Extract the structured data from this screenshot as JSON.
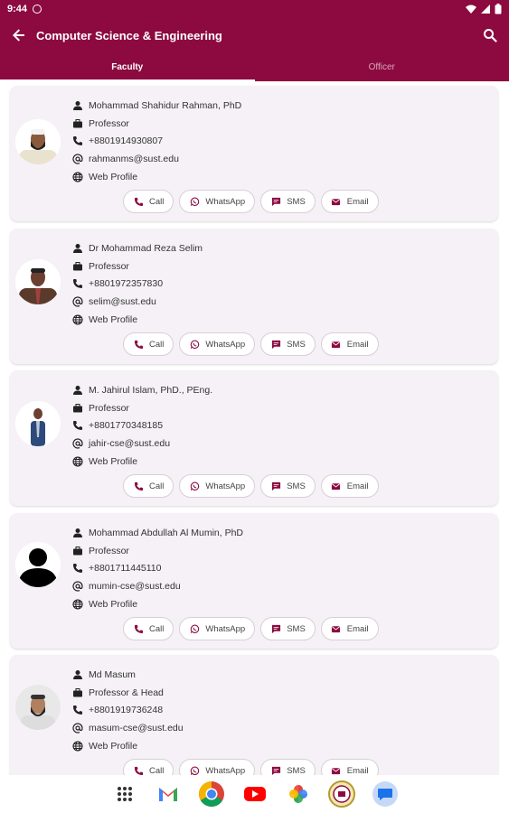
{
  "status_bar": {
    "time": "9:44"
  },
  "app_bar": {
    "title": "Computer Science & Engineering"
  },
  "tabs": [
    {
      "label": "Faculty"
    },
    {
      "label": "Officer"
    }
  ],
  "actions": {
    "call": "Call",
    "whatsapp": "WhatsApp",
    "sms": "SMS",
    "email": "Email"
  },
  "faculty": [
    {
      "name": "Mohammad Shahidur Rahman, PhD",
      "designation": "Professor",
      "phone": "+8801914930807",
      "email": "rahmanms@sust.edu",
      "web": "Web Profile"
    },
    {
      "name": "Dr Mohammad Reza Selim",
      "designation": "Professor",
      "phone": "+8801972357830",
      "email": "selim@sust.edu",
      "web": "Web Profile"
    },
    {
      "name": "M. Jahirul Islam, PhD., PEng.",
      "designation": "Professor",
      "phone": "+8801770348185",
      "email": "jahir-cse@sust.edu",
      "web": "Web Profile"
    },
    {
      "name": "Mohammad Abdullah Al Mumin, PhD",
      "designation": "Professor",
      "phone": "+8801711445110",
      "email": "mumin-cse@sust.edu",
      "web": "Web Profile"
    },
    {
      "name": "Md Masum",
      "designation": "Professor & Head",
      "phone": "+8801919736248",
      "email": "masum-cse@sust.edu",
      "web": "Web Profile"
    }
  ],
  "colors": {
    "primary": "#8c0a40",
    "card_bg": "#f5f1f6"
  },
  "dock_apps": [
    "apps-grid-icon",
    "gmail-icon",
    "chrome-icon",
    "youtube-icon",
    "photos-icon",
    "university-seal-icon",
    "messages-icon"
  ]
}
